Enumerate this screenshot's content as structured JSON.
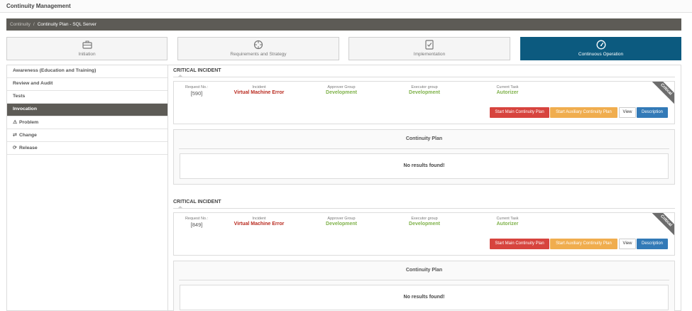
{
  "app": {
    "title": "Continuity Management"
  },
  "breadcrumb": {
    "items": [
      "Continuity",
      "Continuity Plan - SQL Server"
    ],
    "separator": "/"
  },
  "stages": [
    {
      "label": "Initiation",
      "icon": "briefcase-icon",
      "active": false
    },
    {
      "label": "Requirements and Strategy",
      "icon": "crosshair-icon",
      "active": false
    },
    {
      "label": "Implementation",
      "icon": "checklist-icon",
      "active": false
    },
    {
      "label": "Continuous Operation",
      "icon": "speedometer-icon",
      "active": true
    }
  ],
  "sidebar": {
    "items": [
      {
        "label": "Awareness (Education and Training)",
        "icon": "",
        "active": false
      },
      {
        "label": "Review and Audit",
        "icon": "",
        "active": false
      },
      {
        "label": "Tests",
        "icon": "",
        "active": false
      },
      {
        "label": "Invocation",
        "icon": "",
        "active": true
      },
      {
        "label": "Problem",
        "icon": "warning-icon",
        "active": false
      },
      {
        "label": "Change",
        "icon": "swap-arrows-icon",
        "active": false
      },
      {
        "label": "Release",
        "icon": "refresh-icon",
        "active": false
      }
    ]
  },
  "incidents": [
    {
      "section_title": "CRITICAL INCIDENT",
      "request_label": "Request No.:",
      "request_no": "[590]",
      "incident_label": "Incident",
      "incident": "Virtual Machine Error",
      "approver_label": "Approver Group",
      "approver": "Development",
      "executor_label": "Executor group",
      "executor": "Development",
      "task_label": "Current Task",
      "task": "Autorizer",
      "ribbon": "Critical",
      "buttons": {
        "main": "Start Main Continuity Plan",
        "auxiliary": "Start Auxiliary Continuity Plan",
        "view": "View",
        "description": "Description"
      },
      "plan": {
        "title": "Continuity Plan",
        "empty": "No results found!"
      }
    },
    {
      "section_title": "CRITICAL INCIDENT",
      "request_label": "Request No.:",
      "request_no": "[849]",
      "incident_label": "Incident",
      "incident": "Virtual Machine Error",
      "approver_label": "Approver Group",
      "approver": "Development",
      "executor_label": "Executor group",
      "executor": "Development",
      "task_label": "Current Task",
      "task": "Autorizer",
      "ribbon": "Critical",
      "buttons": {
        "main": "Start Main Continuity Plan",
        "auxiliary": "Start Auxiliary Continuity Plan",
        "view": "View",
        "description": "Description"
      },
      "plan": {
        "title": "Continuity Plan",
        "empty": "No results found!"
      }
    }
  ],
  "colors": {
    "active_stage": "#0c5a7f",
    "breadcrumb_bg": "#5d5b56",
    "incident_red": "#b92a1f",
    "group_green": "#7fb24a",
    "btn_main": "#d7443e",
    "btn_auxiliary": "#f0ad4e",
    "btn_description": "#337ab7"
  }
}
